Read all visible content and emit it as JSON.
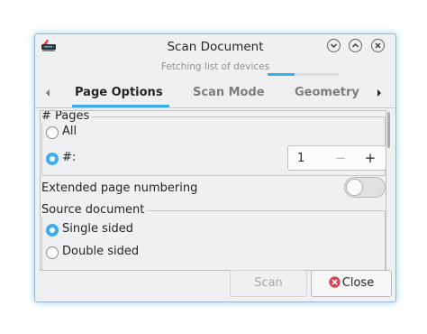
{
  "window": {
    "title": "Scan Document"
  },
  "status": {
    "text": "Fetching list of devices",
    "progress": 0.38
  },
  "tabs": [
    {
      "label": "Page Options",
      "active": true
    },
    {
      "label": "Scan Mode",
      "active": false
    },
    {
      "label": "Geometry",
      "active": false
    }
  ],
  "pages": {
    "group_title": "# Pages",
    "all_label": "All",
    "count_label": "#:",
    "selected": "count",
    "count_value": "1",
    "decrement_label": "−",
    "increment_label": "+"
  },
  "extended_numbering": {
    "label": "Extended page numbering",
    "enabled": false
  },
  "source": {
    "group_title": "Source document",
    "single_label": "Single sided",
    "double_label": "Double sided",
    "selected": "single"
  },
  "buttons": {
    "scan_label": "Scan",
    "close_label": "Close"
  },
  "icons": {
    "app": "scanner-app-icon",
    "minimize": "chevron-down-icon",
    "maximize": "chevron-up-icon",
    "close": "close-icon",
    "tab_prev": "triangle-left-icon",
    "tab_next": "triangle-right-icon",
    "close_button": "red-circle-x-icon"
  },
  "colors": {
    "accent": "#3daee9",
    "close_icon": "#da4453"
  }
}
